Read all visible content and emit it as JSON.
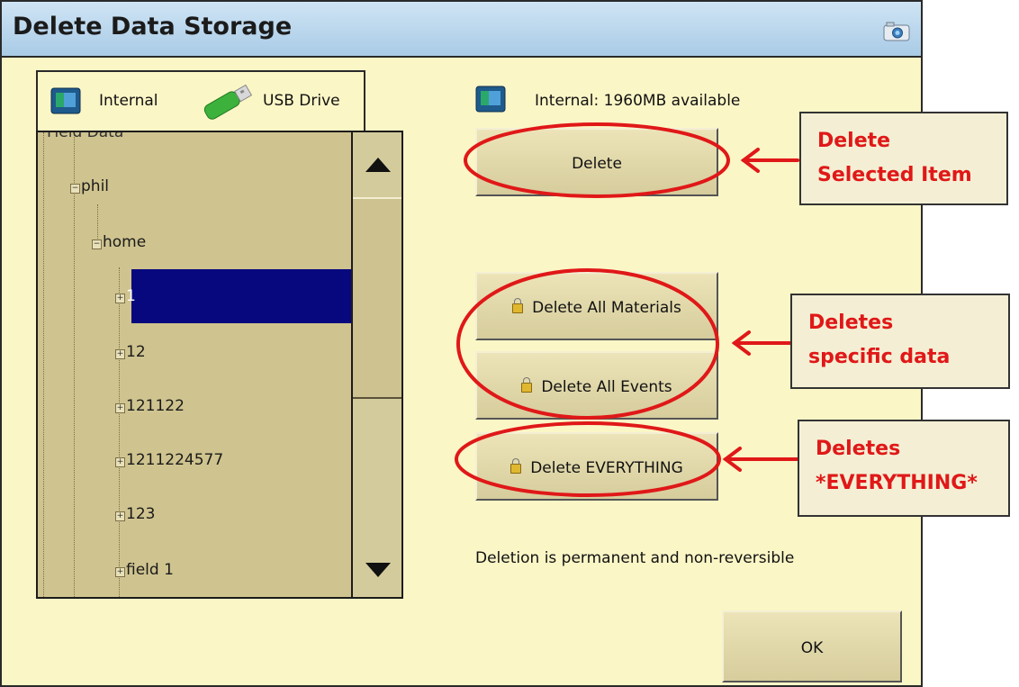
{
  "window": {
    "title": "Delete Data Storage",
    "camera_icon": "camera-icon"
  },
  "tabs": [
    {
      "label": "Internal",
      "icon": "internal-storage-icon"
    },
    {
      "label": "USB Drive",
      "icon": "usb-drive-icon"
    }
  ],
  "tree": {
    "cut_root": "Field Data",
    "nodes": [
      "phil",
      "home",
      "1",
      "12",
      "121122",
      "1211224577",
      "123",
      "field 1"
    ],
    "selected": "1"
  },
  "storage": {
    "info": "Internal: 1960MB available"
  },
  "buttons": {
    "delete": "Delete",
    "delete_all_materials": "Delete All Materials",
    "delete_all_events": "Delete All Events",
    "delete_everything": "Delete EVERYTHING",
    "ok": "OK"
  },
  "warning": "Deletion is permanent and non-reversible",
  "callouts": {
    "delete_selected": [
      "Delete",
      "Selected Item"
    ],
    "deletes_specific": [
      "Deletes",
      "specific data"
    ],
    "deletes_everything": [
      "Deletes",
      "*EVERYTHING*"
    ]
  },
  "colors": {
    "annotation_red": "#e01818",
    "selection": "#08087e",
    "background": "#fbf6c6"
  }
}
